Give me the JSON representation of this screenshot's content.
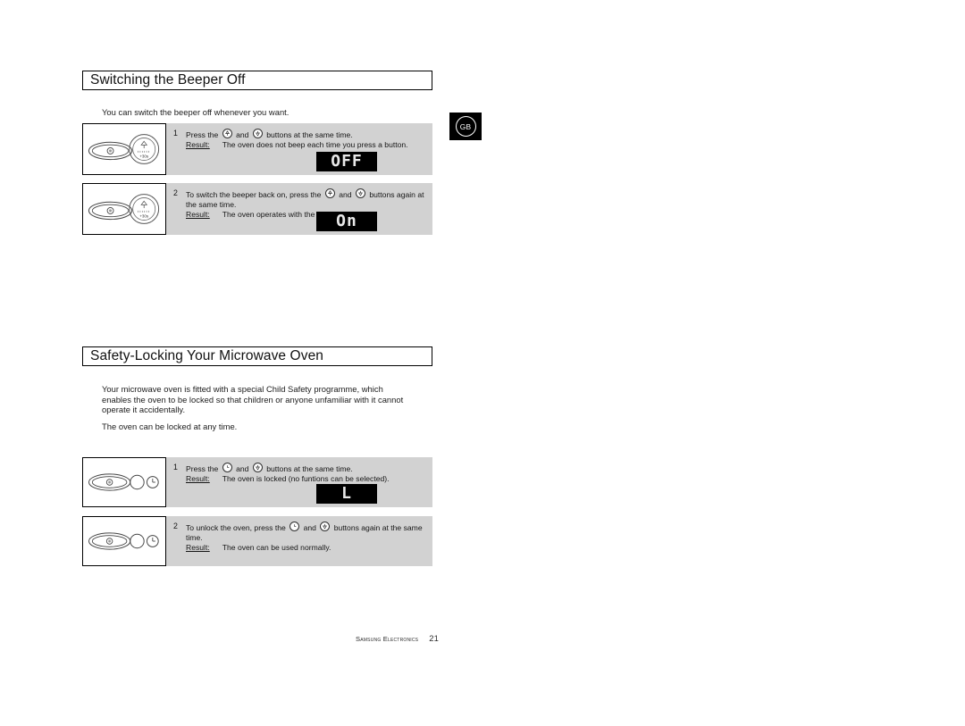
{
  "page": {
    "language_badge": "GB",
    "footer_brand": "Samsung Electronics",
    "footer_page_number": "21"
  },
  "sections": [
    {
      "heading": "Switching the Beeper Off",
      "intro": "You can switch the beeper off whenever you want.",
      "steps": [
        {
          "number": "1",
          "instruction_before": "Press the",
          "icon_a": "power-up-circle-icon",
          "conjunction": "and",
          "icon_b": "stop-down-circle-icon",
          "instruction_after": "buttons at the same time.",
          "result_label": "Result:",
          "result_text": "The oven does not beep each time you press a button.",
          "display": "OFF",
          "panel_buttons": [
            "door-release-oval",
            "plus-30s-dial"
          ]
        },
        {
          "number": "2",
          "instruction_before": "To switch the beeper back on, press the",
          "icon_a": "power-up-circle-icon",
          "conjunction": "and",
          "icon_b": "stop-down-circle-icon",
          "instruction_after": "buttons again at the same time.",
          "result_label": "Result:",
          "result_text": "The oven operates with the beeper on again.",
          "display": "On",
          "panel_buttons": [
            "door-release-oval",
            "plus-30s-dial"
          ]
        }
      ]
    },
    {
      "heading": "Safety-Locking Your Microwave Oven",
      "intro": "Your microwave oven is fitted with a special Child Safety programme, which enables the oven to be  locked  so that children or anyone unfamiliar with it cannot operate it accidentally.",
      "intro2": "The oven can be locked at any time.",
      "steps": [
        {
          "number": "1",
          "instruction_before": "Press the",
          "icon_a": "clock-circle-icon",
          "conjunction": "and",
          "icon_b": "stop-down-circle-icon",
          "instruction_after": "buttons at the same time.",
          "result_label": "Result:",
          "result_text": "The oven is locked (no funtions can be selected).",
          "display": "L",
          "panel_buttons": [
            "door-release-oval",
            "plain-circle",
            "clock-dial"
          ]
        },
        {
          "number": "2",
          "instruction_before": "To unlock the oven, press the",
          "icon_a": "clock-circle-icon",
          "conjunction": "and",
          "icon_b": "stop-down-circle-icon",
          "instruction_after": "buttons again at the same time.",
          "result_label": "Result:",
          "result_text": "The oven can be used normally.",
          "display": "",
          "panel_buttons": [
            "door-release-oval",
            "plain-circle",
            "clock-dial"
          ]
        }
      ]
    }
  ],
  "colors": {
    "step_background": "#d2d2d2",
    "display_background": "#000000",
    "display_text": "#e8e8e8",
    "badge_background": "#000000"
  }
}
